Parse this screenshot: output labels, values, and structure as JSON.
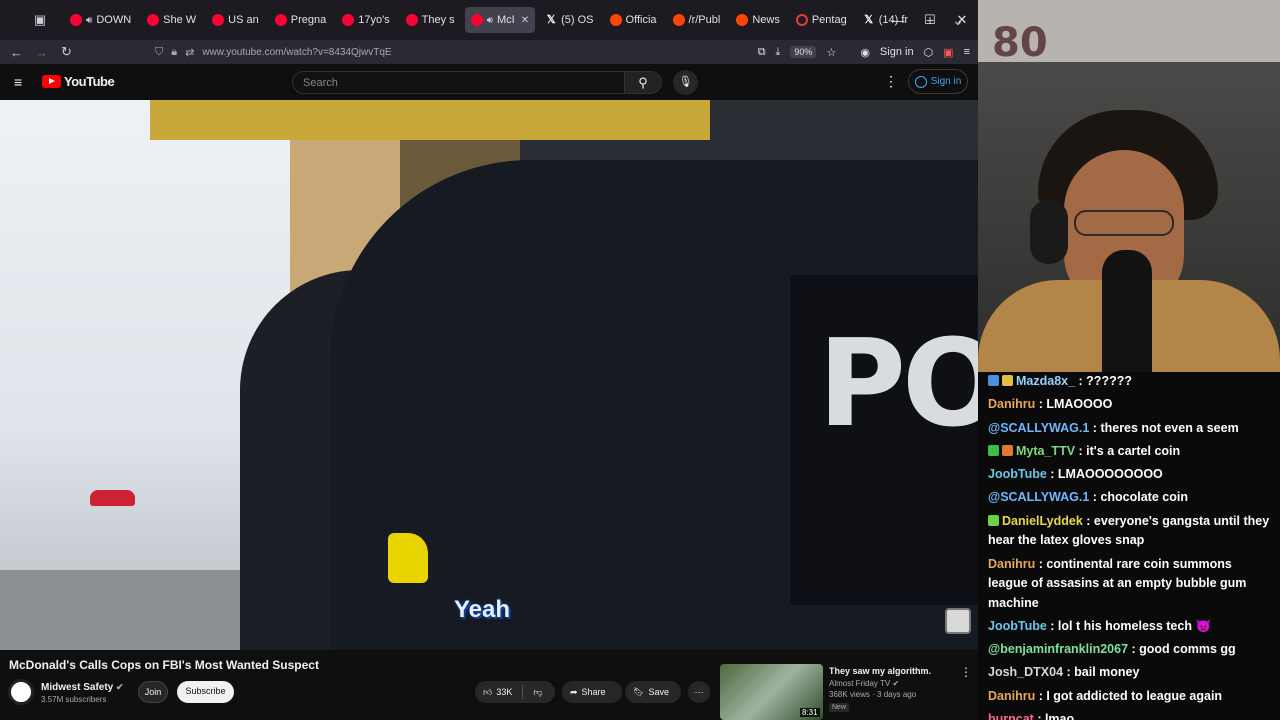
{
  "browser": {
    "tabs": [
      {
        "label": "DOWN",
        "type": "yt",
        "audio": true,
        "active": false
      },
      {
        "label": "She W",
        "type": "yt",
        "audio": false,
        "active": false
      },
      {
        "label": "US an",
        "type": "yt",
        "audio": false,
        "active": false
      },
      {
        "label": "Pregna",
        "type": "yt",
        "audio": false,
        "active": false
      },
      {
        "label": "17yo's",
        "type": "yt",
        "audio": false,
        "active": false
      },
      {
        "label": "They s",
        "type": "yt",
        "audio": false,
        "active": false
      },
      {
        "label": "McI",
        "type": "yt",
        "audio": true,
        "active": true
      },
      {
        "label": "(5) OS",
        "type": "x",
        "audio": false,
        "active": false
      },
      {
        "label": "Officia",
        "type": "rd",
        "audio": false,
        "active": false
      },
      {
        "label": "/r/Publ",
        "type": "rd",
        "audio": false,
        "active": false
      },
      {
        "label": "News",
        "type": "rd",
        "audio": false,
        "active": false
      },
      {
        "label": "Pentag",
        "type": "pg",
        "audio": false,
        "active": false
      },
      {
        "label": "(14) fr",
        "type": "x",
        "audio": false,
        "active": false
      }
    ],
    "url": "www.youtube.com/watch?v=8434QjwvTqE",
    "zoom": "90%",
    "signin_label": "Sign in"
  },
  "youtube": {
    "logo_text": "YouTube",
    "search_placeholder": "Search",
    "signin_label": "Sign in",
    "video": {
      "caption": "Yeah",
      "title": "McDonald's Calls Cops on FBI's Most Wanted Suspect",
      "channel": "Midwest Safety",
      "subscribers": "3.57M subscribers",
      "join_label": "Join",
      "subscribe_label": "Subscribe",
      "likes": "33K",
      "share_label": "Share",
      "save_label": "Save",
      "po_text": "PO"
    },
    "recommended": {
      "title": "They saw my algorithm.",
      "channel": "Almost Friday TV",
      "meta": "368K views · 3 days ago",
      "badge": "New",
      "duration": "8:31"
    }
  },
  "stream": {
    "overlay_logo": "80",
    "chat": [
      {
        "name": "Mazda8x_",
        "color": "#9ad1ff",
        "text": "??????",
        "badges": [
          "#4a90e2",
          "#e0c040"
        ]
      },
      {
        "name": "Danihru",
        "color": "#e8a85a",
        "text": "LMAOOOO",
        "badges": []
      },
      {
        "name": "@SCALLYWAG.1",
        "color": "#6fb8ff",
        "text": "theres not even a seem",
        "badges": []
      },
      {
        "name": "Myta_TTV",
        "color": "#7fd77f",
        "text": "it's a cartel coin",
        "badges": [
          "#3fbf3f",
          "#e07a30"
        ]
      },
      {
        "name": "JoobTube",
        "color": "#69c8e8",
        "text": "LMAOOOOOOOO",
        "badges": []
      },
      {
        "name": "@SCALLYWAG.1",
        "color": "#6fb8ff",
        "text": "chocolate coin",
        "badges": []
      },
      {
        "name": "DanielLyddek",
        "color": "#e6d84e",
        "text": "everyone's gangsta until they hear the latex gloves snap",
        "badges": [
          "#6bd04a"
        ]
      },
      {
        "name": "Danihru",
        "color": "#e8a85a",
        "text": "continental rare coin summons league of assasins at an empty bubble gum machine",
        "badges": []
      },
      {
        "name": "JoobTube",
        "color": "#69c8e8",
        "text": "lol t his homeless tech 👿",
        "badges": []
      },
      {
        "name": "@benjaminfranklin2067",
        "color": "#7fe0a0",
        "text": "good comms gg",
        "badges": []
      },
      {
        "name": "Josh_DTX04",
        "color": "#d8d8d8",
        "text": "bail money",
        "badges": []
      },
      {
        "name": "Danihru",
        "color": "#e8a85a",
        "text": "I got addicted to league again",
        "badges": []
      },
      {
        "name": "burncat",
        "color": "#ff6b8a",
        "text": "lmao",
        "badges": []
      }
    ]
  }
}
